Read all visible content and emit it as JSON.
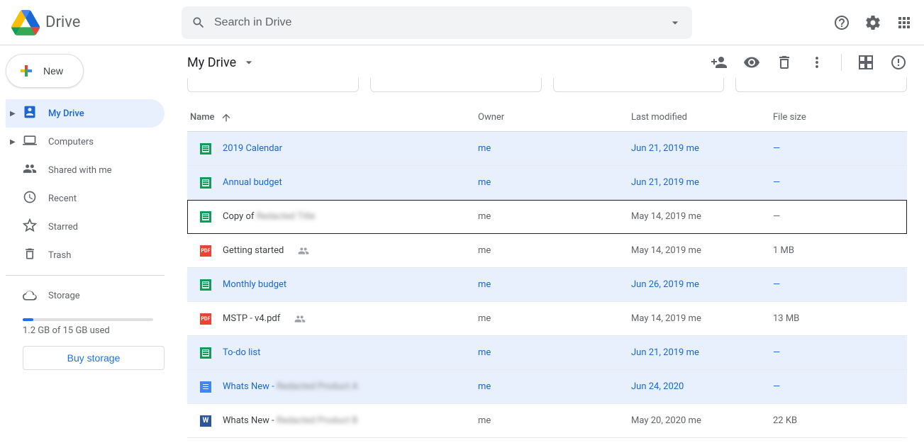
{
  "app": {
    "name": "Drive"
  },
  "search": {
    "placeholder": "Search in Drive"
  },
  "new_button": {
    "label": "New"
  },
  "sidebar": {
    "items": [
      {
        "label": "My Drive",
        "icon": "mydrive",
        "active": true,
        "expandable": true
      },
      {
        "label": "Computers",
        "icon": "computers",
        "active": false,
        "expandable": true
      },
      {
        "label": "Shared with me",
        "icon": "shared",
        "active": false,
        "expandable": false
      },
      {
        "label": "Recent",
        "icon": "recent",
        "active": false,
        "expandable": false
      },
      {
        "label": "Starred",
        "icon": "starred",
        "active": false,
        "expandable": false
      },
      {
        "label": "Trash",
        "icon": "trash",
        "active": false,
        "expandable": false
      }
    ],
    "storage": {
      "label": "Storage",
      "used_text": "1.2 GB of 15 GB used",
      "percent": 8,
      "buy_label": "Buy storage"
    }
  },
  "breadcrumb": {
    "title": "My Drive"
  },
  "columns": {
    "name": "Name",
    "owner": "Owner",
    "modified": "Last modified",
    "size": "File size"
  },
  "files": [
    {
      "name": "2019 Calendar",
      "type": "sheets",
      "owner": "me",
      "modified": "Jun 21, 2019",
      "modified_by": "me",
      "size": "—",
      "selected": true,
      "shared": false
    },
    {
      "name": "Annual budget",
      "type": "sheets",
      "owner": "me",
      "modified": "Jun 21, 2019",
      "modified_by": "me",
      "size": "—",
      "selected": true,
      "shared": false
    },
    {
      "name": "Copy of",
      "name_blur": "Redacted Title",
      "type": "sheets",
      "owner": "me",
      "modified": "May 14, 2019",
      "modified_by": "me",
      "size": "—",
      "selected": false,
      "focused": true,
      "shared": false
    },
    {
      "name": "Getting started",
      "type": "pdf",
      "owner": "me",
      "modified": "May 14, 2019",
      "modified_by": "me",
      "size": "1 MB",
      "selected": false,
      "shared": true
    },
    {
      "name": "Monthly budget",
      "type": "sheets",
      "owner": "me",
      "modified": "Jun 26, 2019",
      "modified_by": "me",
      "size": "—",
      "selected": true,
      "shared": false
    },
    {
      "name": "MSTP - v4.pdf",
      "type": "pdf",
      "owner": "me",
      "modified": "May 14, 2019",
      "modified_by": "me",
      "size": "13 MB",
      "selected": false,
      "shared": true
    },
    {
      "name": "To-do list",
      "type": "sheets",
      "owner": "me",
      "modified": "Jun 21, 2019",
      "modified_by": "me",
      "size": "—",
      "selected": true,
      "shared": false
    },
    {
      "name": "Whats New -",
      "name_blur": "Redacted Product A",
      "type": "docs",
      "owner": "me",
      "modified": "Jun 24, 2020",
      "modified_by": "",
      "size": "—",
      "selected": true,
      "shared": false
    },
    {
      "name": "Whats New -",
      "name_blur": "Redacted Product B",
      "type": "word",
      "owner": "me",
      "modified": "May 20, 2020",
      "modified_by": "me",
      "size": "22 KB",
      "selected": false,
      "shared": false
    }
  ]
}
